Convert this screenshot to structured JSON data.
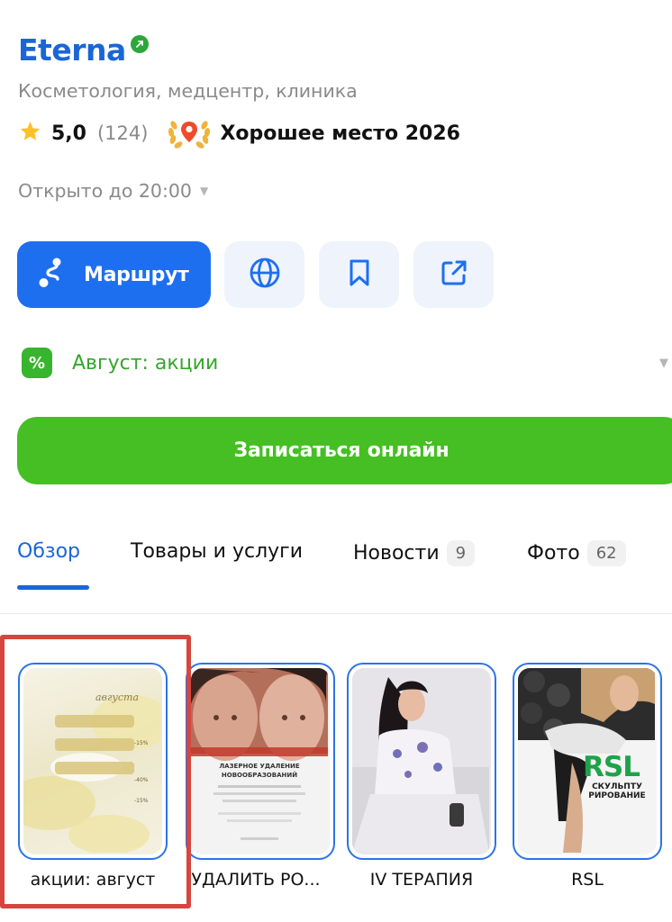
{
  "business": {
    "name": "Eterna",
    "category": "Косметология, медцентр, клиника",
    "rating": "5,0",
    "reviews_count": "(124)",
    "award": "Хорошее место 2026",
    "hours": "Открыто до 20:00"
  },
  "actions": {
    "route_label": "Маршрут",
    "website_icon": "globe-icon",
    "bookmark_icon": "bookmark-icon",
    "share_icon": "share-icon"
  },
  "promo": {
    "icon_text": "%",
    "label": "Август: акции"
  },
  "booking": {
    "label": "Записаться онлайн"
  },
  "tabs": [
    {
      "label": "Обзор",
      "badge": ""
    },
    {
      "label": "Товары и услуги",
      "badge": ""
    },
    {
      "label": "Новости",
      "badge": "9"
    },
    {
      "label": "Фото",
      "badge": "62"
    }
  ],
  "stories": [
    {
      "label": "акции: август",
      "cover_title": "августа",
      "rows": [
        "-15%",
        "-40%",
        "-15%"
      ]
    },
    {
      "label": "УДАЛИТЬ РО...",
      "cover_title": "ЛАЗЕРНОЕ УДАЛЕНИЕ НОВООБРАЗОВАНИЙ"
    },
    {
      "label": "IV ТЕРАПИЯ"
    },
    {
      "label": "RSL",
      "brand": "RSL",
      "subtitle": "СКУЛЬПТУ РИРОВАНИЕ"
    }
  ],
  "colors": {
    "brand_blue": "#1a66d8",
    "route_blue": "#1e6fef",
    "book_green": "#45bf23",
    "promo_green": "#36a62c",
    "highlight_red": "#d6453e"
  }
}
